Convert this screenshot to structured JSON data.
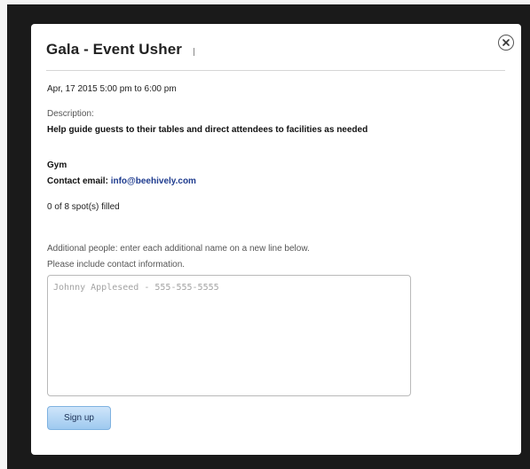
{
  "modal": {
    "title": "Gala - Event Usher",
    "datetime": "Apr, 17 2015 5:00 pm to 6:00 pm",
    "description_label": "Description:",
    "description": "Help guide guests to their tables and direct attendees to facilities as needed",
    "location": "Gym",
    "contact_label": "Contact email:",
    "contact_email": "info@beehively.com",
    "spots": "0 of 8 spot(s) filled",
    "additional_line1": "Additional people: enter each additional name on a new line below.",
    "additional_line2": "Please include contact information.",
    "textarea_placeholder": "Johnny Appleseed - 555-555-5555",
    "textarea_value": "",
    "signup_label": "Sign up",
    "close_icon": "close-icon"
  }
}
